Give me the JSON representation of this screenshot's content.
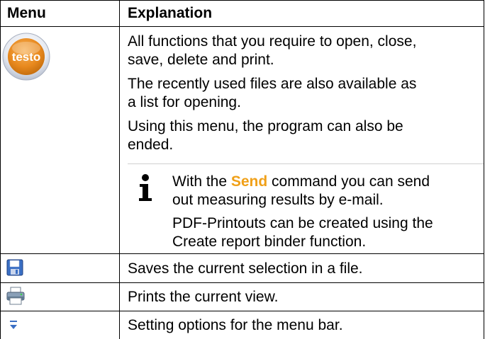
{
  "table": {
    "headers": {
      "menu": "Menu",
      "explanation": "Explanation"
    },
    "rows": [
      {
        "icon": "testo-logo-icon",
        "paragraphs": [
          [
            "All functions that you require to open, close,",
            "save, delete and print."
          ],
          [
            "The recently used files are also available as",
            "a list for opening."
          ],
          [
            "Using this menu, the program can also be",
            "ended."
          ]
        ],
        "note": {
          "icon": "info-icon",
          "line1_prefix": "With the ",
          "line1_highlight": "Send",
          "line1_suffix": " command you can send",
          "line2": "out measuring results by e-mail.",
          "line3": "PDF-Printouts can be created using the",
          "line4": "Create report binder function."
        }
      },
      {
        "icon": "save-disk-icon",
        "text": "Saves the current selection in a file."
      },
      {
        "icon": "printer-icon",
        "text": "Prints the current view."
      },
      {
        "icon": "menu-bar-options-icon",
        "text": "Setting options for the menu bar."
      }
    ]
  },
  "colors": {
    "highlight": "#f0a018",
    "testo_logo": "#e8891e",
    "divider": "#000000"
  }
}
